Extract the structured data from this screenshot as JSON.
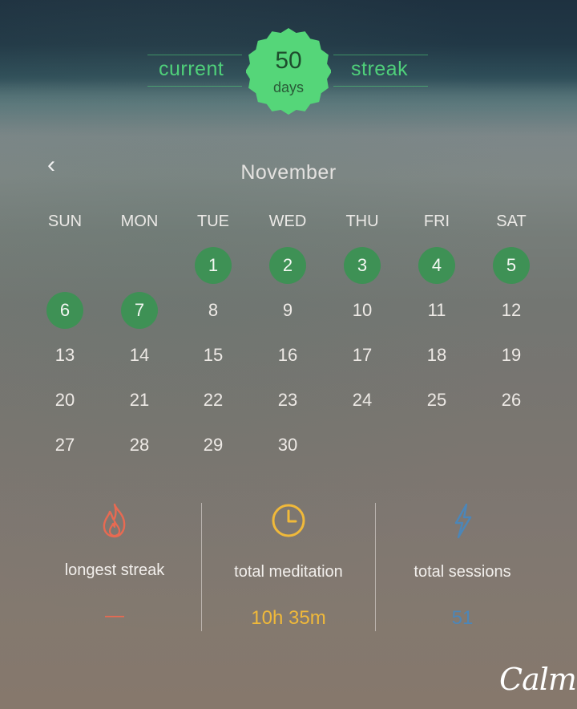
{
  "streak": {
    "left_label": "current",
    "right_label": "streak",
    "count": "50",
    "unit": "days",
    "badge_color": "#55d679"
  },
  "calendar": {
    "month": "November",
    "weekdays": [
      "SUN",
      "MON",
      "TUE",
      "WED",
      "THU",
      "FRI",
      "SAT"
    ],
    "days": [
      "1",
      "2",
      "3",
      "4",
      "5",
      "6",
      "7",
      "8",
      "9",
      "10",
      "11",
      "12",
      "13",
      "14",
      "15",
      "16",
      "17",
      "18",
      "19",
      "20",
      "21",
      "22",
      "23",
      "24",
      "25",
      "26",
      "27",
      "28",
      "29",
      "30"
    ],
    "active_days": [
      "1",
      "2",
      "3",
      "4",
      "5",
      "6",
      "7"
    ],
    "active_color": "#3e9155"
  },
  "stats": [
    {
      "icon": "flame-icon",
      "label": "longest streak",
      "value": "—",
      "color": "#e86a52"
    },
    {
      "icon": "clock-icon",
      "label": "total meditation",
      "value": "10h 35m",
      "color": "#f0b93a"
    },
    {
      "icon": "lightning-icon",
      "label": "total sessions",
      "value": "51",
      "color": "#4c86b8"
    }
  ],
  "brand": {
    "logo": "Calm"
  }
}
